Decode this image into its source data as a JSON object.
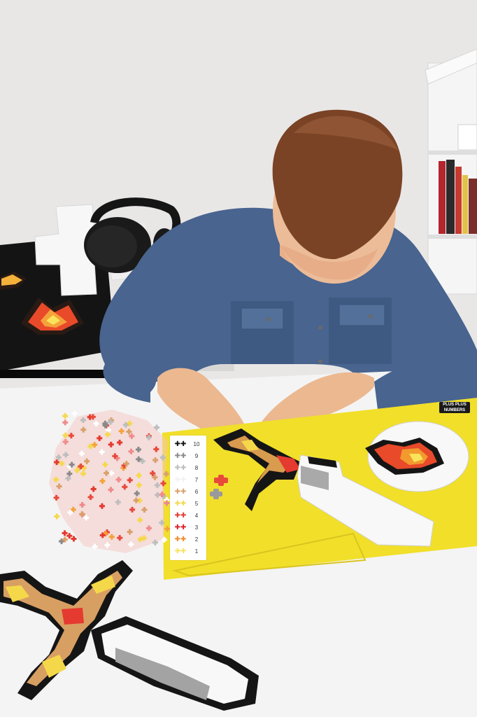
{
  "scene": {
    "description_label": "",
    "brand_label": "PLUS PLUS NUMBERS",
    "number_strip": {
      "rows": [
        {
          "num": "10",
          "color": "#111111"
        },
        {
          "num": "9",
          "color": "#8a8a8a"
        },
        {
          "num": "8",
          "color": "#bdbdbd"
        },
        {
          "num": "7",
          "color": "#f2f2f2"
        },
        {
          "num": "6",
          "color": "#d9a06a"
        },
        {
          "num": "5",
          "color": "#f6d84a"
        },
        {
          "num": "4",
          "color": "#e53a2f"
        },
        {
          "num": "3",
          "color": "#d8232b"
        },
        {
          "num": "2",
          "color": "#f08a2a"
        },
        {
          "num": "1",
          "color": "#f9e35a"
        }
      ]
    },
    "colors": {
      "wall": "#e9e7e6",
      "table": "#f4f4f4",
      "mat": "#f1df2a",
      "shirt": "#48648f",
      "hair": "#7a4325",
      "skin": "#e9b58f"
    }
  }
}
